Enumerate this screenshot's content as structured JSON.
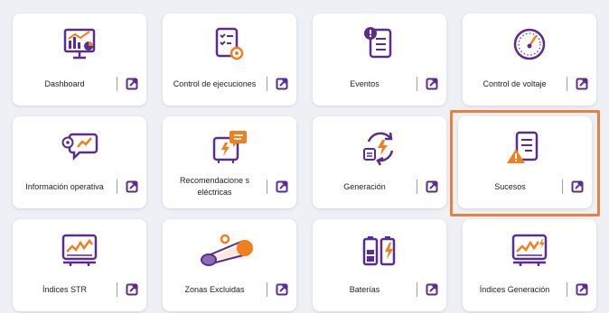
{
  "colors": {
    "purple": "#5b2c8f",
    "orange": "#f07f1e",
    "highlight": "#e8813f",
    "background": "#eef0f5"
  },
  "tiles": [
    {
      "label": "Dashboard",
      "icon": "dashboard-chart-icon"
    },
    {
      "label": "Control de ejecuciones",
      "icon": "control-checklist-icon"
    },
    {
      "label": "Eventos",
      "icon": "event-alert-icon"
    },
    {
      "label": "Control de voltaje",
      "icon": "gauge-icon"
    },
    {
      "label": "Información operativa",
      "icon": "info-chat-icon"
    },
    {
      "label": "Recomendacione s eléctricas",
      "icon": "electric-recommendation-icon"
    },
    {
      "label": "Generación",
      "icon": "generation-cycle-icon"
    },
    {
      "label": "Sucesos",
      "icon": "warning-document-icon"
    },
    {
      "label": "Índices STR",
      "icon": "monitor-chart-icon"
    },
    {
      "label": "Zonas Excluidas",
      "icon": "zone-cone-icon"
    },
    {
      "label": "Baterías",
      "icon": "battery-icon"
    },
    {
      "label": "Índices Generación",
      "icon": "monitor-generation-icon"
    }
  ]
}
